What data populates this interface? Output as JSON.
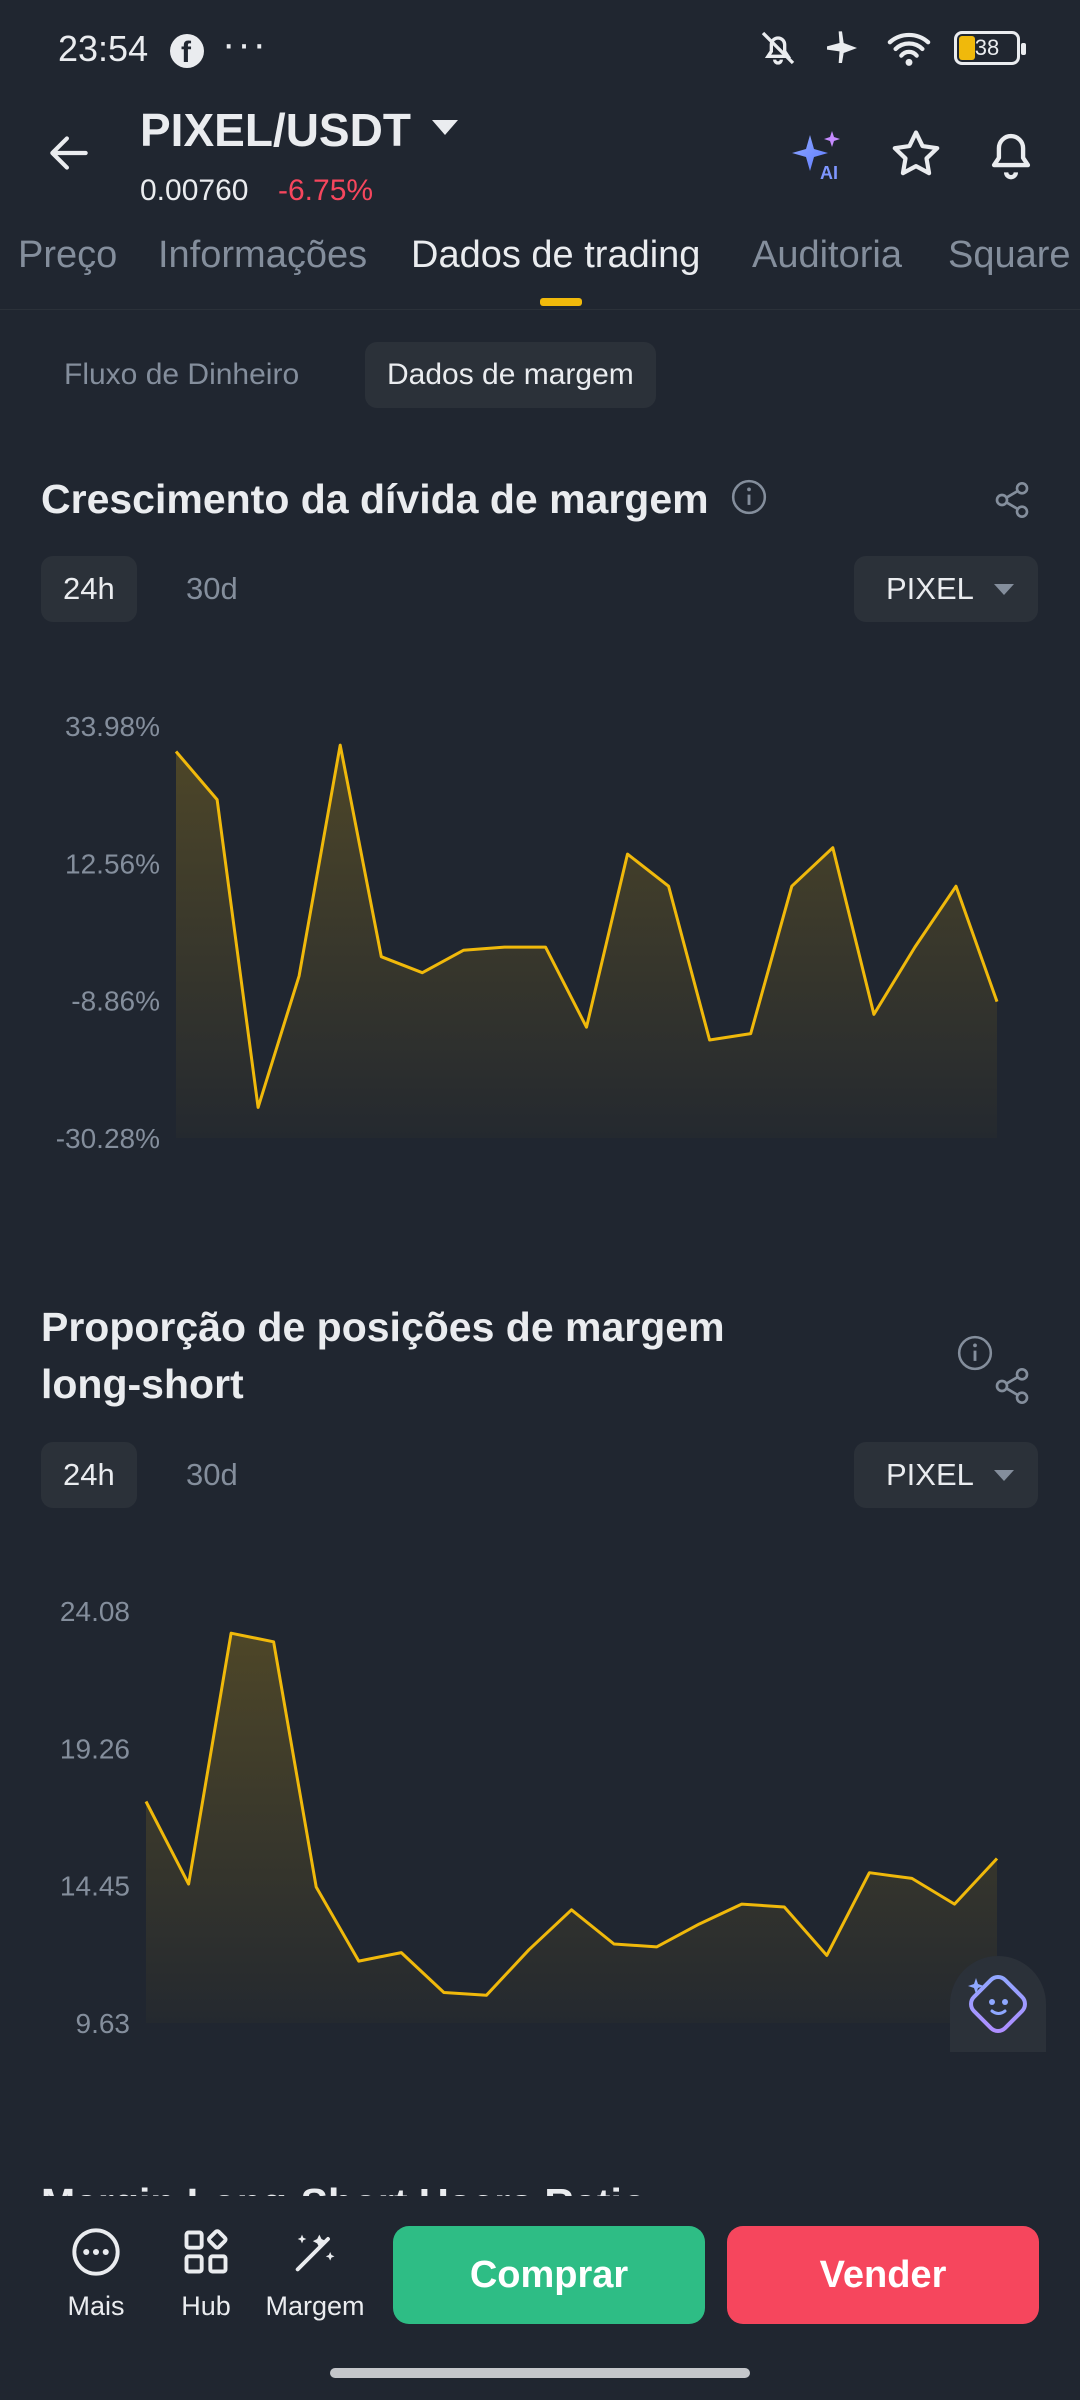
{
  "status_bar": {
    "time": "23:54",
    "more": "···",
    "battery": "38"
  },
  "header": {
    "pair": "PIXEL/USDT",
    "price": "0.00760",
    "change": "-6.75%",
    "change_color": "#f6465d"
  },
  "tabs": [
    {
      "label": "Preço"
    },
    {
      "label": "Informações"
    },
    {
      "label": "Dados de trading"
    },
    {
      "label": "Auditoria"
    },
    {
      "label": "Square"
    }
  ],
  "subtabs": [
    {
      "label": "Fluxo de Dinheiro"
    },
    {
      "label": "Dados de margem"
    }
  ],
  "section1": {
    "title": "Crescimento da dívida de margem",
    "range_24h": "24h",
    "range_30d": "30d",
    "asset": "PIXEL"
  },
  "section2": {
    "title_line1": "Proporção de posições de margem",
    "title_line2": "long-short",
    "range_24h": "24h",
    "range_30d": "30d",
    "asset": "PIXEL"
  },
  "section3": {
    "title_partial": "Margin Long-Short Users Ratio"
  },
  "bottom_bar": {
    "more": "Mais",
    "hub": "Hub",
    "margin": "Margem",
    "buy": "Comprar",
    "sell": "Vender"
  },
  "colors": {
    "accent": "#f0b90b",
    "buy": "#2ebd85",
    "sell": "#f6465d",
    "background": "#202630"
  },
  "chart_data": [
    {
      "type": "area",
      "ytick_labels": [
        "33.98%",
        "12.56%",
        "-8.86%",
        "-30.28%"
      ],
      "ytick_values": [
        33.98,
        12.56,
        -8.86,
        -30.28
      ],
      "ylim": [
        -30.28,
        33.98
      ],
      "series": [
        {
          "values": [
            30,
            22.5,
            -25.5,
            -5,
            31,
            -2,
            -4.5,
            -1,
            -0.5,
            -0.5,
            -13,
            14,
            9,
            -15,
            -14,
            9,
            15,
            -11,
            -0.5,
            9,
            -9
          ]
        }
      ]
    },
    {
      "type": "area",
      "ytick_labels": [
        "24.08",
        "19.26",
        "14.45",
        "9.63"
      ],
      "ytick_values": [
        24.08,
        19.26,
        14.45,
        9.63
      ],
      "ylim": [
        9.63,
        24.08
      ],
      "series": [
        {
          "values": [
            17.4,
            14.5,
            23.3,
            23,
            14.4,
            11.8,
            12.1,
            10.7,
            10.6,
            12.2,
            13.6,
            12.4,
            12.3,
            13.1,
            13.8,
            13.7,
            12,
            14.9,
            14.7,
            13.8,
            15.4
          ]
        }
      ]
    }
  ]
}
